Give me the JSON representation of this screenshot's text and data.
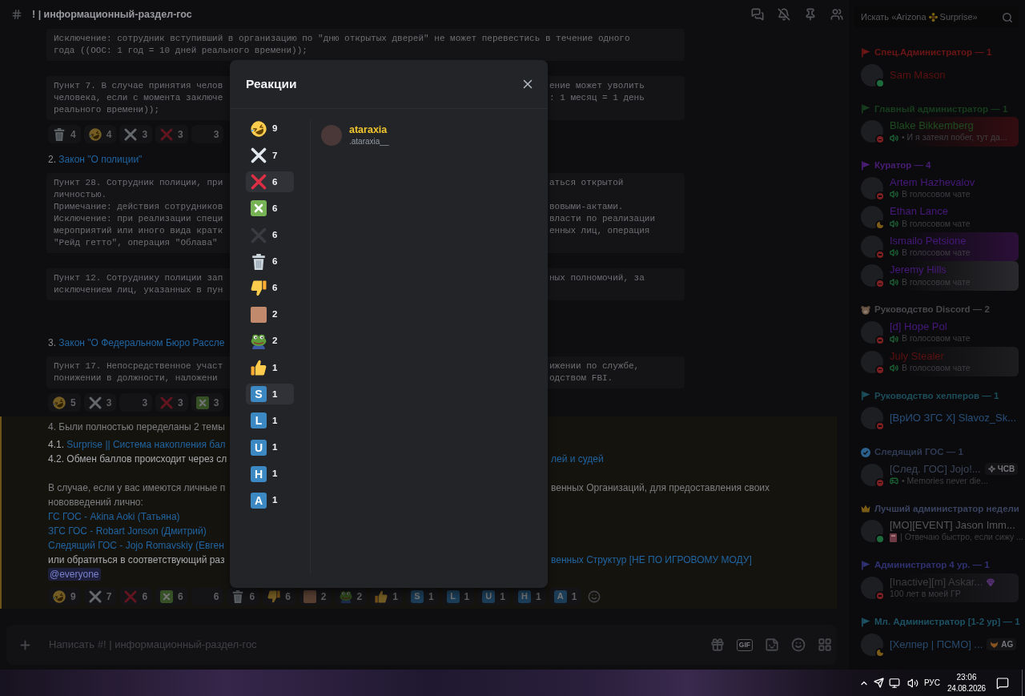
{
  "channel_header": {
    "title": "! | информационный-раздел-гос"
  },
  "search": {
    "placeholder_parts": [
      "Искать «Arizona",
      "Surprise»"
    ]
  },
  "chat": [
    {
      "kind": "code",
      "lines": [
        [
          "Исключение: сотрудник вступивший в организацию по \"дню открытых дверей\" не может перевестись в течение одного"
        ],
        [
          "года ((OOC: 1 год = 10 дней реального времени));"
        ]
      ]
    },
    {
      "kind": "code",
      "lines": [
        [
          "Пункт 7. В случае принятия челов",
          "ение может уволить"
        ],
        [
          "человека, если с момента заключе",
          ": 1 месяц = 1 день"
        ],
        [
          "реального времени));"
        ]
      ]
    },
    {
      "kind": "reactions",
      "items": [
        {
          "kind": "trash",
          "count": "4"
        },
        {
          "kind": "rofl",
          "count": "4"
        },
        {
          "kind": "cross_white",
          "count": "3"
        },
        {
          "kind": "cross_red",
          "count": "3"
        },
        {
          "kind": "cross_dark",
          "count": "3"
        }
      ]
    },
    {
      "kind": "heading",
      "number": "2.",
      "link": "Закон \"О полиции\""
    },
    {
      "kind": "code",
      "lines": [
        [
          "Пункт 28. Сотрудник полиции, при",
          "аться открытой"
        ],
        [
          "личностью."
        ],
        [
          "Примечание: действия сотрудников",
          "вовыми-актами."
        ],
        [
          "Исключение: при реализации специ",
          "власти по реализации"
        ],
        [
          "мероприятий или иного вида кратк",
          "енных лиц, операция"
        ],
        [
          "\"Рейд гетто\", операция \"Облава\""
        ]
      ]
    },
    {
      "kind": "code",
      "lines": [
        [
          "Пункт 12. Сотруднику полиции зап",
          "ных полномочий, за"
        ],
        [
          "исключением лиц, указанных в пун"
        ]
      ]
    },
    {
      "kind": "heading",
      "number": "3.",
      "link": "Закон \"О Федеральном Бюро Рассле"
    },
    {
      "kind": "code",
      "lines": [
        [
          "Пункт 17. Непосредственное участ",
          "ижении по службе,"
        ],
        [
          "понижении в должности, наложени",
          "одством FBI."
        ]
      ]
    },
    {
      "kind": "reactions",
      "items": [
        {
          "kind": "rofl",
          "count": "5"
        },
        {
          "kind": "cross_white",
          "count": "3"
        },
        {
          "kind": "cross_dark",
          "count": "3"
        },
        {
          "kind": "cross_red",
          "count": "3"
        },
        {
          "kind": "cross_green",
          "count": "3"
        }
      ]
    },
    {
      "kind": "highlight",
      "paragraphs": [
        [
          {
            "left": [
              {
                "kind": "text",
                "text": "4. Были полностью переделаны 2 темы"
              }
            ]
          }
        ],
        [
          {
            "left": [
              {
                "kind": "strong",
                "text": "4.1. "
              },
              {
                "kind": "link",
                "text": "Surprise || Система накопления бал"
              }
            ]
          },
          {
            "left": [
              {
                "kind": "strong",
                "text": "4.2. Обмен баллов происходит через сл"
              }
            ],
            "right": [
              {
                "kind": "link",
                "text": "лей и судей"
              }
            ]
          }
        ],
        [
          {
            "left": [
              {
                "kind": "text",
                "text": "В случае, если у вас имеются личные п"
              }
            ],
            "right": [
              {
                "kind": "text",
                "text": "венных Организаций, для предоставления своих"
              }
            ]
          },
          {
            "left": [
              {
                "kind": "text",
                "text": "нововведений лично:"
              }
            ]
          },
          {
            "left": [
              {
                "kind": "link",
                "text": "ГС ГОС - Akina Aoki (Татьяна)"
              }
            ]
          },
          {
            "left": [
              {
                "kind": "link",
                "text": "ЗГС ГОС - Robart Jonson (Дмитрий)"
              }
            ]
          },
          {
            "left": [
              {
                "kind": "link",
                "text": "Следящий ГОС - Jojo Romavskiy (Евген"
              }
            ]
          },
          {
            "left": [
              {
                "kind": "strong",
                "text": "или обратиться в соответствующий раз"
              }
            ],
            "right": [
              {
                "kind": "link",
                "text": "венных Структур [НЕ ПО ИГРОВОМУ МОДУ]"
              }
            ]
          },
          {
            "left": [
              {
                "kind": "mention",
                "text": "@everyone"
              }
            ]
          }
        ]
      ],
      "reactions": [
        {
          "kind": "rofl",
          "count": "9"
        },
        {
          "kind": "cross_white",
          "count": "7"
        },
        {
          "kind": "cross_red",
          "count": "6"
        },
        {
          "kind": "cross_green",
          "count": "6"
        },
        {
          "kind": "cross_dark",
          "count": "6"
        },
        {
          "kind": "trash",
          "count": "6"
        },
        {
          "kind": "thumbs_down",
          "count": "6"
        },
        {
          "kind": "face_photo",
          "count": "2"
        },
        {
          "kind": "frog",
          "count": "2"
        },
        {
          "kind": "thumbs_up",
          "count": "1"
        },
        {
          "kind": "letter",
          "letter": "S",
          "count": "1"
        },
        {
          "kind": "letter",
          "letter": "L",
          "count": "1"
        },
        {
          "kind": "letter",
          "letter": "U",
          "count": "1"
        },
        {
          "kind": "letter",
          "letter": "H",
          "count": "1"
        },
        {
          "kind": "letter",
          "letter": "A",
          "count": "1"
        }
      ]
    }
  ],
  "composer": {
    "placeholder": "Написать #! | информационный-раздел-гос",
    "gif_label": "GIF"
  },
  "modal": {
    "title": "Реакции",
    "reactions": [
      {
        "kind": "rofl",
        "count": "9",
        "selected": false
      },
      {
        "kind": "cross_white",
        "count": "7",
        "selected": false
      },
      {
        "kind": "cross_red",
        "count": "6",
        "selected": true
      },
      {
        "kind": "cross_green",
        "count": "6",
        "selected": false
      },
      {
        "kind": "cross_dark",
        "count": "6",
        "selected": false
      },
      {
        "kind": "trash",
        "count": "6",
        "selected": false
      },
      {
        "kind": "thumbs_down",
        "count": "6",
        "selected": false
      },
      {
        "kind": "face_photo",
        "count": "2",
        "selected": false
      },
      {
        "kind": "frog",
        "count": "2",
        "selected": false
      },
      {
        "kind": "thumbs_up",
        "count": "1",
        "selected": false
      },
      {
        "kind": "letter",
        "letter": "S",
        "count": "1",
        "selected": true
      },
      {
        "kind": "letter",
        "letter": "L",
        "count": "1",
        "selected": false
      },
      {
        "kind": "letter",
        "letter": "U",
        "count": "1",
        "selected": false
      },
      {
        "kind": "letter",
        "letter": "H",
        "count": "1",
        "selected": false
      },
      {
        "kind": "letter",
        "letter": "A",
        "count": "1",
        "selected": false
      }
    ],
    "users": [
      {
        "display_name": "ataraxia",
        "username": ".ataraxia__"
      }
    ]
  },
  "members": [
    {
      "title": "Спец.Администратор — 1",
      "color": "#6b1515",
      "kind": "pennant",
      "members": [
        {
          "name": "Sam Mason",
          "color": "#5c1111",
          "kind": "online"
        }
      ]
    },
    {
      "title": "Главный администратор — 1",
      "color": "#173d1d",
      "kind": "pennant",
      "members": [
        {
          "name": "Blake Bikkemberg",
          "color": "#1f4d20",
          "kind": "dnd",
          "nameplate": {
            "color": "#330c10"
          },
          "activity": {
            "kind": "voice",
            "text": "• И я затеял побег, тут да..."
          }
        }
      ]
    },
    {
      "title": "Куратор — 4",
      "color": "#4a1d75",
      "kind": "pennant",
      "members": [
        {
          "name": "Artem Hazhevalov",
          "color": "#46197a",
          "kind": "dnd",
          "activity": {
            "kind": "voice",
            "text": "В голосовом чате"
          }
        },
        {
          "name": "Ethan Lance",
          "color": "#46197a",
          "kind": "idle",
          "activity": {
            "kind": "voice",
            "text": "В голосовом чате"
          }
        },
        {
          "name": "Ismailo Petsione",
          "color": "#46197a",
          "kind": "dnd",
          "nameplate": {
            "color": "#2b0f38"
          },
          "activity": {
            "kind": "voice",
            "text": "В голосовом чате"
          }
        },
        {
          "name": "Jeremy Hills",
          "color": "#46197a",
          "kind": "dnd",
          "nameplate": {
            "color": "#2a2a2e"
          },
          "activity": {
            "kind": "voice",
            "text": "В голосовом чате"
          }
        }
      ]
    },
    {
      "title": "Руководство Discord — 2",
      "color": "#48484c",
      "kind": "animal",
      "members": [
        {
          "name": "[d] Hope Pol",
          "color": "#46197a",
          "kind": "dnd",
          "activity": {
            "kind": "voice",
            "text": "В голосовом чате"
          }
        },
        {
          "name": "July Stealer",
          "color": "#5c1111",
          "kind": "dnd",
          "nameplate": {
            "color": "#1d1d20"
          },
          "activity": {
            "kind": "voice",
            "text": "В голосовом чате"
          }
        }
      ]
    },
    {
      "title": "Руководство хелперов — 1",
      "color": "#1c4e5c",
      "kind": "pennant",
      "members": [
        {
          "name": "[ВрИО ЗГС Х] Slavoz_Sk...",
          "color": "#284f7a",
          "kind": "dnd"
        }
      ]
    },
    {
      "title": "Следящий ГОС — 1",
      "color": "#2f3a52",
      "kind": "check",
      "members": [
        {
          "name": "[След. ГОС] Jojo!...",
          "color": "#3a4458",
          "kind": "dnd",
          "tag": {
            "kind": "sparkle",
            "text": "ЧСВ"
          },
          "activity": {
            "kind": "game",
            "text": "• Memories never die..."
          }
        }
      ]
    },
    {
      "title": "Лучший администратор недели",
      "color": "#3a4460",
      "kind": "crown",
      "members": [
        {
          "name": "[MO][EVENT] Jason Imm...",
          "color": "#56565a",
          "kind": "online",
          "activity": {
            "kind": "book",
            "text": "| Отвечаю быстро, если сижу ..."
          }
        }
      ]
    },
    {
      "title": "Администратор 4 ур. — 1",
      "color": "#2f3170",
      "kind": "pennant",
      "members": [
        {
          "name": "[Inactive][m] Askar...",
          "color": "#3c3c40",
          "kind": "dnd",
          "badge": {
            "kind": "gem"
          },
          "nameplate": {
            "color": "#1a1a1e"
          },
          "activity": {
            "kind": "plain",
            "text": "100 лет в моей ГР"
          }
        }
      ]
    },
    {
      "title": "Мл. Администратор [1-2 ур] — 1",
      "color": "#1c5264",
      "kind": "pennant",
      "members": [
        {
          "name": "[Хелпер | ПСМО] ...",
          "color": "#284a6c",
          "kind": "idle",
          "tag": {
            "kind": "fox",
            "text": "AG"
          }
        }
      ]
    }
  ],
  "taskbar": {
    "language": "РУС",
    "time": "23:06",
    "date": "24.08.2026"
  }
}
